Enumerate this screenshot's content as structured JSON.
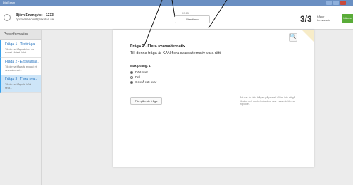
{
  "window": {
    "title": "DigiExam"
  },
  "header": {
    "user_name": "Björn Enanqvist - 1233",
    "user_email": "bjorn.enanqvist@skolan.se",
    "timer_label": "00:15",
    "view_button": "Visa timer",
    "counter": "3/3",
    "counter_label": "frågor besvarade",
    "submit_label": "Lämna in"
  },
  "sidebar": {
    "header": "Provinformation",
    "items": [
      {
        "title": "Fråga 1 - Textfråga",
        "desc": "Till denna fråga skriver du svaret i fritext. Inlet..."
      },
      {
        "title": "Fråga 2 - Ett svarsal...",
        "desc": "Till denna fråga är endast ett svarsalternat..."
      },
      {
        "title": "Fråga 3 - Flera sva...",
        "desc": "Till denna fråga är KAN flera..."
      }
    ]
  },
  "question": {
    "heading": "Fråga 3 - Flera svarsalternativ",
    "text": "Till denna fråga är KAN flera svarsalternativ vara rätt.",
    "points": "Max poäng: 1",
    "options": [
      "Rätt svar",
      "Fel",
      "Också rätt svar"
    ],
    "checked": [
      true,
      false,
      true
    ],
    "prev_button": "Föregående fråga",
    "note": "Bet har är sista frågan på provet! Glöm inte att gå tillbaka och dubbelkolla dina svar innan du lämnar in provet."
  },
  "accent_colors": {
    "title_bar": "#6a8fc2",
    "link": "#2775c0",
    "submit": "#5aac39",
    "active": "#cde5f8"
  }
}
